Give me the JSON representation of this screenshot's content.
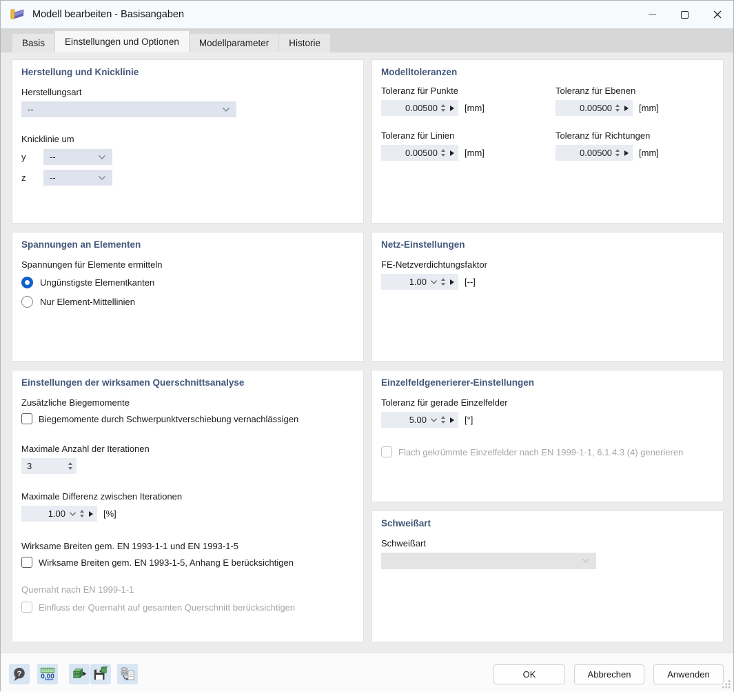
{
  "window": {
    "title": "Modell bearbeiten - Basisangaben"
  },
  "tabs": [
    {
      "label": "Basis"
    },
    {
      "label": "Einstellungen und Optionen"
    },
    {
      "label": "Modellparameter"
    },
    {
      "label": "Historie"
    }
  ],
  "herstellung": {
    "title": "Herstellung und Knicklinie",
    "herstellungsart_label": "Herstellungsart",
    "herstellungsart_value": "--",
    "knicklinie_label": "Knicklinie um",
    "axis_y_label": "y",
    "axis_y_value": "--",
    "axis_z_label": "z",
    "axis_z_value": "--"
  },
  "modelltoleranzen": {
    "title": "Modelltoleranzen",
    "fields": [
      {
        "label": "Toleranz für Punkte",
        "value": "0.00500",
        "unit": "[mm]"
      },
      {
        "label": "Toleranz für Ebenen",
        "value": "0.00500",
        "unit": "[mm]"
      },
      {
        "label": "Toleranz für Linien",
        "value": "0.00500",
        "unit": "[mm]"
      },
      {
        "label": "Toleranz für Richtungen",
        "value": "0.00500",
        "unit": "[mm]"
      }
    ]
  },
  "spannungen": {
    "title": "Spannungen an Elementen",
    "group_label": "Spannungen für Elemente ermitteln",
    "option1": "Ungünstigste Elementkanten",
    "option2": "Nur Element-Mittellinien"
  },
  "netz": {
    "title": "Netz-Einstellungen",
    "factor_label": "FE-Netzverdichtungsfaktor",
    "factor_value": "1.00",
    "factor_unit": "[--]"
  },
  "querschnitt": {
    "title": "Einstellungen der wirksamen Querschnittsanalyse",
    "biegemomente_label": "Zusätzliche Biegemomente",
    "biegemomente_checkbox": "Biegemomente durch Schwerpunktverschiebung vernachlässigen",
    "iterationen_label": "Maximale Anzahl der Iterationen",
    "iterationen_value": "3",
    "differenz_label": "Maximale Differenz zwischen Iterationen",
    "differenz_value": "1.00",
    "differenz_unit": "[%]",
    "breiten_label": "Wirksame Breiten gem. EN 1993-1-1 und EN 1993-1-5",
    "breiten_checkbox": "Wirksame Breiten gem. EN 1993-1-5, Anhang E berücksichtigen",
    "quernaht_label": "Quernaht nach EN 1999-1-1",
    "quernaht_checkbox": "Einfluss der Quernaht auf gesamten Querschnitt berücksichtigen"
  },
  "einzelfeld": {
    "title": "Einzelfeldgenerierer-Einstellungen",
    "toleranz_label": "Toleranz für gerade Einzelfelder",
    "toleranz_value": "5.00",
    "toleranz_unit": "[°]",
    "checkbox_label": "Flach gekrümmte Einzelfelder nach EN 1999-1-1, 6.1.4.3 (4) generieren"
  },
  "schweissart": {
    "title": "Schweißart",
    "label": "Schweißart",
    "value": ""
  },
  "footer": {
    "ok": "OK",
    "cancel": "Abbrechen",
    "apply": "Anwenden",
    "help_icon_text": "?",
    "units_icon_text": "0,00",
    "icons": [
      "help-icon",
      "units-icon",
      "apply-parameters-icon",
      "save-default-icon",
      "transfer-settings-icon"
    ]
  },
  "colors": {
    "accent_blue": "#0e62c9",
    "section_title": "#44587b",
    "field_bg": "#e9ecf2",
    "dropdown_bg": "#dfe3ed"
  }
}
